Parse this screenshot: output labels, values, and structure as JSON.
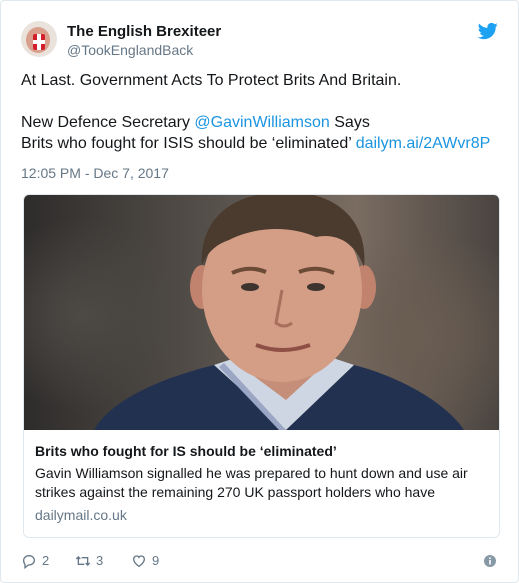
{
  "author": {
    "name": "The English Brexiteer",
    "handle": "@TookEnglandBack"
  },
  "tweet": {
    "line1": "At Last. Government Acts To Protect Brits And Britain.",
    "line2_prefix": "New Defence Secretary ",
    "mention": "@GavinWilliamson",
    "line2_suffix": " Says",
    "line3_prefix": "Brits who fought for ISIS should be ‘eliminated’ ",
    "link": "dailym.ai/2AWvr8P",
    "timestamp": "12:05 PM - Dec 7, 2017"
  },
  "card": {
    "title": "Brits who fought for IS should be ‘eliminated’",
    "description": "Gavin Williamson signalled he was prepared to hunt down and use air strikes against the remaining 270 UK passport holders who have",
    "domain": "dailymail.co.uk"
  },
  "actions": {
    "replies": "2",
    "retweets": "3",
    "likes": "9"
  },
  "icons": {
    "brand": "twitter-bird-icon",
    "reply": "reply-icon",
    "retweet": "retweet-icon",
    "like": "heart-icon",
    "info": "info-icon"
  },
  "colors": {
    "link": "#1b95e0",
    "secondary_text": "#657786",
    "border": "#e1e8ed",
    "brand": "#1da1f2"
  }
}
